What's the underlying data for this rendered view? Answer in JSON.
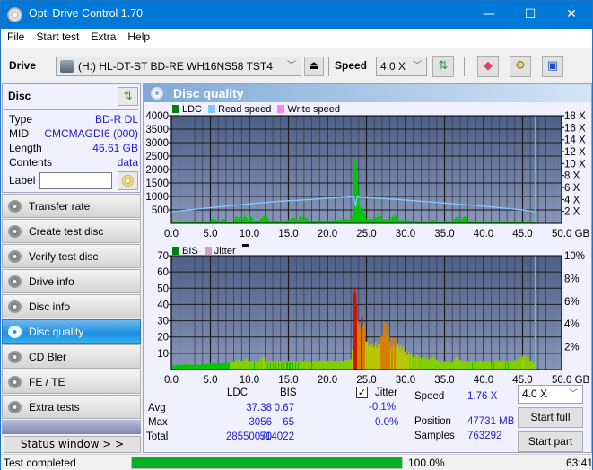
{
  "window": {
    "title": "Opti Drive Control 1.70",
    "minimize": "—",
    "maximize": "☐",
    "close": "✕"
  },
  "menu": [
    "File",
    "Start test",
    "Extra",
    "Help"
  ],
  "toolbar": {
    "drive_label": "Drive",
    "drive_value": "(H:)  HL-DT-ST BD-RE  WH16NS58 TST4",
    "speed_label": "Speed",
    "speed_value": "4.0 X",
    "icons": [
      "eject-icon",
      "refresh-icon",
      "erase-icon",
      "settings-icon",
      "save-icon"
    ]
  },
  "disc": {
    "header": "Disc",
    "rows": [
      {
        "key": "Type",
        "value": "BD-R DL"
      },
      {
        "key": "MID",
        "value": "CMCMAGDI6 (000)"
      },
      {
        "key": "Length",
        "value": "46.61 GB"
      },
      {
        "key": "Contents",
        "value": "data"
      }
    ],
    "label_key": "Label",
    "label_value": ""
  },
  "nav": [
    {
      "label": "Transfer rate",
      "active": false
    },
    {
      "label": "Create test disc",
      "active": false
    },
    {
      "label": "Verify test disc",
      "active": false
    },
    {
      "label": "Drive info",
      "active": false
    },
    {
      "label": "Disc info",
      "active": false
    },
    {
      "label": "Disc quality",
      "active": true
    },
    {
      "label": "CD Bler",
      "active": false
    },
    {
      "label": "FE / TE",
      "active": false
    },
    {
      "label": "Extra tests",
      "active": false
    }
  ],
  "status_window_button": "Status window > >",
  "panel_title": "Disc quality",
  "colors": {
    "ldc": "#008000",
    "read_speed": "#80c8ff",
    "write_speed": "#ff80ff",
    "bis": "#008000",
    "jitter": "#d0a0d0",
    "plot_bg_top": "#4e5f85",
    "plot_bg_bottom": "#8796b8",
    "bar_green": "#00c800",
    "progress": "#06b025"
  },
  "chart_data": [
    {
      "type": "bar",
      "title": "LDC / Read speed",
      "legend": [
        "LDC",
        "Read speed",
        "Write speed"
      ],
      "legend_placement": "top-left",
      "xlabel": "GB",
      "xlim": [
        0,
        50
      ],
      "x_ticks": [
        "0.0",
        "5.0",
        "10.0",
        "15.0",
        "20.0",
        "25.0",
        "30.0",
        "35.0",
        "40.0",
        "45.0",
        "50.0 GB"
      ],
      "ylim": [
        0,
        4000
      ],
      "y_ticks": [
        "4000",
        "3500",
        "3000",
        "2500",
        "2000",
        "1500",
        "1000",
        "500"
      ],
      "y2lim": [
        0,
        18
      ],
      "y2_ticks": [
        "18 X",
        "16 X",
        "14 X",
        "12 X",
        "10 X",
        "8 X",
        "6 X",
        "4 X",
        "2 X"
      ],
      "grid": true,
      "end_marker_gb": 46.61,
      "ldc_series": {
        "name": "LDC",
        "points": [
          [
            0,
            40
          ],
          [
            1,
            50
          ],
          [
            2,
            60
          ],
          [
            2.5,
            80
          ],
          [
            3,
            60
          ],
          [
            4,
            70
          ],
          [
            5,
            90
          ],
          [
            5.2,
            200
          ],
          [
            6,
            70
          ],
          [
            6.7,
            180
          ],
          [
            7,
            60
          ],
          [
            8,
            80
          ],
          [
            8.2,
            300
          ],
          [
            8.5,
            250
          ],
          [
            9,
            90
          ],
          [
            9.3,
            350
          ],
          [
            9.8,
            120
          ],
          [
            10,
            380
          ],
          [
            10.5,
            90
          ],
          [
            11,
            100
          ],
          [
            11.8,
            280
          ],
          [
            12,
            350
          ],
          [
            12.5,
            100
          ],
          [
            13,
            110
          ],
          [
            14,
            90
          ],
          [
            15,
            120
          ],
          [
            15.5,
            250
          ],
          [
            16,
            100
          ],
          [
            16.5,
            320
          ],
          [
            17,
            120
          ],
          [
            17.2,
            280
          ],
          [
            17.5,
            110
          ],
          [
            18,
            100
          ],
          [
            19,
            120
          ],
          [
            20,
            110
          ],
          [
            21,
            130
          ],
          [
            22,
            150
          ],
          [
            23,
            180
          ],
          [
            23.2,
            450
          ],
          [
            23.4,
            3056
          ],
          [
            23.6,
            2400
          ],
          [
            23.8,
            1800
          ],
          [
            24,
            700
          ],
          [
            24.4,
            640
          ],
          [
            24.8,
            250
          ],
          [
            25,
            180
          ],
          [
            26,
            180
          ],
          [
            26.5,
            350
          ],
          [
            27,
            170
          ],
          [
            28,
            150
          ],
          [
            28.5,
            350
          ],
          [
            29,
            130
          ],
          [
            30,
            120
          ],
          [
            31,
            100
          ],
          [
            32,
            90
          ],
          [
            33,
            80
          ],
          [
            33.5,
            150
          ],
          [
            34,
            80
          ],
          [
            35,
            90
          ],
          [
            36,
            80
          ],
          [
            36.5,
            280
          ],
          [
            37,
            100
          ],
          [
            37.5,
            300
          ],
          [
            38,
            100
          ],
          [
            39,
            80
          ],
          [
            40,
            60
          ],
          [
            41,
            60
          ],
          [
            42,
            70
          ],
          [
            43,
            50
          ],
          [
            44,
            60
          ],
          [
            45,
            50
          ],
          [
            46,
            40
          ],
          [
            46.61,
            30
          ]
        ]
      },
      "read_speed_series": {
        "name": "Read speed",
        "unit": "X",
        "points": [
          [
            0,
            1.7
          ],
          [
            0.1,
            2.0
          ],
          [
            2,
            2.2
          ],
          [
            4,
            2.5
          ],
          [
            6,
            2.75
          ],
          [
            8,
            3.0
          ],
          [
            10,
            3.25
          ],
          [
            12,
            3.5
          ],
          [
            14,
            3.7
          ],
          [
            16,
            3.85
          ],
          [
            18,
            4.0
          ],
          [
            20,
            4.2
          ],
          [
            22,
            4.35
          ],
          [
            23.4,
            4.45
          ],
          [
            23.6,
            2.8
          ],
          [
            23.8,
            4.4
          ],
          [
            25,
            4.3
          ],
          [
            27,
            4.15
          ],
          [
            29,
            4.0
          ],
          [
            31,
            3.8
          ],
          [
            33,
            3.6
          ],
          [
            35,
            3.4
          ],
          [
            37,
            3.2
          ],
          [
            39,
            3.0
          ],
          [
            41,
            2.75
          ],
          [
            43,
            2.5
          ],
          [
            45,
            2.25
          ],
          [
            46.61,
            2.0
          ]
        ]
      }
    },
    {
      "type": "bar",
      "title": "BIS / Jitter",
      "legend": [
        "BIS",
        "Jitter"
      ],
      "legend_placement": "top-left",
      "xlabel": "GB",
      "xlim": [
        0,
        50
      ],
      "x_ticks": [
        "0.0",
        "5.0",
        "10.0",
        "15.0",
        "20.0",
        "25.0",
        "30.0",
        "35.0",
        "40.0",
        "45.0",
        "50.0 GB"
      ],
      "ylim": [
        0,
        70
      ],
      "y_ticks": [
        "70",
        "60",
        "50",
        "40",
        "30",
        "20",
        "10"
      ],
      "y2lim": [
        0,
        10
      ],
      "y2_ticks": [
        "10%",
        "8%",
        "6%",
        "4%",
        "2%"
      ],
      "grid": true,
      "end_marker_gb": 46.61,
      "bis_series": {
        "name": "BIS",
        "points": [
          [
            0,
            3
          ],
          [
            1,
            3
          ],
          [
            2,
            3.5
          ],
          [
            3,
            3
          ],
          [
            4,
            3.5
          ],
          [
            5,
            4
          ],
          [
            6,
            4
          ],
          [
            7,
            4.5
          ],
          [
            8,
            5
          ],
          [
            8.5,
            7
          ],
          [
            9,
            5
          ],
          [
            9.5,
            8
          ],
          [
            10,
            5
          ],
          [
            11,
            5
          ],
          [
            11.8,
            9
          ],
          [
            12,
            5
          ],
          [
            13,
            5
          ],
          [
            14,
            5
          ],
          [
            15,
            5
          ],
          [
            16,
            5
          ],
          [
            17,
            6
          ],
          [
            18,
            5
          ],
          [
            19,
            6
          ],
          [
            20,
            6
          ],
          [
            21,
            6
          ],
          [
            22,
            6
          ],
          [
            23,
            7
          ],
          [
            23.2,
            20
          ],
          [
            23.4,
            65
          ],
          [
            23.6,
            47
          ],
          [
            23.8,
            37
          ],
          [
            24,
            25
          ],
          [
            24.2,
            33
          ],
          [
            24.4,
            36
          ],
          [
            24.6,
            30
          ],
          [
            24.8,
            22
          ],
          [
            25,
            18
          ],
          [
            25.5,
            15
          ],
          [
            26,
            17
          ],
          [
            26.5,
            15
          ],
          [
            27,
            25
          ],
          [
            27.3,
            33
          ],
          [
            27.6,
            25
          ],
          [
            28,
            18
          ],
          [
            28.5,
            20
          ],
          [
            29,
            16
          ],
          [
            29.5,
            14
          ],
          [
            30,
            12
          ],
          [
            30.5,
            10
          ],
          [
            31,
            9
          ],
          [
            32,
            8
          ],
          [
            33,
            7
          ],
          [
            33.5,
            9
          ],
          [
            34,
            6
          ],
          [
            35,
            5
          ],
          [
            36,
            5
          ],
          [
            36.5,
            9
          ],
          [
            37,
            6
          ],
          [
            38,
            5
          ],
          [
            39,
            5
          ],
          [
            40,
            6
          ],
          [
            41,
            5
          ],
          [
            42,
            6
          ],
          [
            43,
            5
          ],
          [
            44,
            6
          ],
          [
            45,
            9
          ],
          [
            45.5,
            8
          ],
          [
            46,
            6
          ],
          [
            46.61,
            4
          ]
        ]
      },
      "jitter_series": {
        "name": "Jitter",
        "points": []
      }
    }
  ],
  "stats": {
    "col_ldc": "LDC",
    "col_bis": "BIS",
    "rows": [
      {
        "label": "Avg",
        "ldc": "37.38",
        "bis": "0.67"
      },
      {
        "label": "Max",
        "ldc": "3056",
        "bis": "65"
      },
      {
        "label": "Total",
        "ldc": "28550070",
        "bis": "514022"
      }
    ],
    "jitter_label": "Jitter",
    "jitter_checked": true,
    "jitter_avg": "-0.1%",
    "jitter_max": "0.0%",
    "speed_label": "Speed",
    "speed_value": "1.76 X",
    "position_label": "Position",
    "position_value": "47731 MB",
    "samples_label": "Samples",
    "samples_value": "763292",
    "speed_select": "4.0 X",
    "start_full": "Start full",
    "start_part": "Start part"
  },
  "statusbar": {
    "text": "Test completed",
    "progress": 1.0,
    "percent": "100.0%",
    "time": "63:41"
  }
}
